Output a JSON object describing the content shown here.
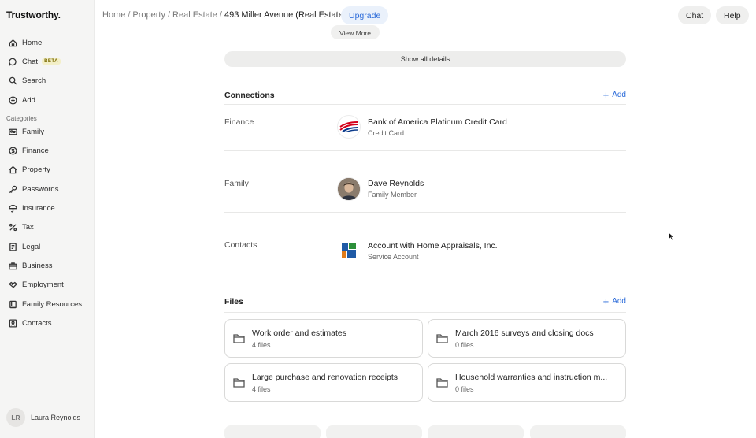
{
  "app": {
    "logo": "Trustworthy."
  },
  "sidebar": {
    "items": [
      {
        "label": "Home",
        "icon": "home-icon"
      },
      {
        "label": "Chat",
        "icon": "chat-icon",
        "badge": "BETA"
      },
      {
        "label": "Search",
        "icon": "search-icon"
      },
      {
        "label": "Add",
        "icon": "plus-circle-icon"
      }
    ],
    "categories_label": "Categories",
    "categories": [
      {
        "label": "Family",
        "icon": "id-card-icon"
      },
      {
        "label": "Finance",
        "icon": "dollar-circle-icon"
      },
      {
        "label": "Property",
        "icon": "house-icon"
      },
      {
        "label": "Passwords",
        "icon": "key-icon"
      },
      {
        "label": "Insurance",
        "icon": "umbrella-icon"
      },
      {
        "label": "Tax",
        "icon": "percent-icon"
      },
      {
        "label": "Legal",
        "icon": "document-icon"
      },
      {
        "label": "Business",
        "icon": "briefcase-icon"
      },
      {
        "label": "Employment",
        "icon": "handshake-icon"
      },
      {
        "label": "Family Resources",
        "icon": "book-icon"
      },
      {
        "label": "Contacts",
        "icon": "contact-icon"
      }
    ],
    "user": {
      "initials": "LR",
      "name": "Laura Reynolds"
    }
  },
  "header": {
    "breadcrumbs": [
      "Home",
      "Property",
      "Real Estate"
    ],
    "current": "493 Miller Avenue (Real Estate)",
    "separator": "/",
    "upgrade_label": "Upgrade",
    "chat_label": "Chat",
    "help_label": "Help"
  },
  "main": {
    "view_more_label": "View More",
    "show_all_label": "Show all details",
    "connections": {
      "title": "Connections",
      "add_label": "Add",
      "rows": [
        {
          "category": "Finance",
          "name": "Bank of America Platinum Credit Card",
          "subtitle": "Credit Card",
          "logo": "bank-of-america-logo"
        },
        {
          "category": "Family",
          "name": "Dave Reynolds",
          "subtitle": "Family Member",
          "logo": "person-avatar"
        },
        {
          "category": "Contacts",
          "name": "Account with Home Appraisals, Inc.",
          "subtitle": "Service Account",
          "logo": "home-appraisals-logo"
        }
      ]
    },
    "files": {
      "title": "Files",
      "add_label": "Add",
      "items": [
        {
          "title": "Work order and estimates",
          "count": "4 files"
        },
        {
          "title": "March 2016 surveys and closing docs",
          "count": "0 files"
        },
        {
          "title": "Large purchase and renovation receipts",
          "count": "4 files"
        },
        {
          "title": "Household warranties and instruction m...",
          "count": "0 files"
        }
      ]
    }
  },
  "colors": {
    "accent": "#2a6ad9",
    "sidebar_bg": "#f5f5f4",
    "beta_bg": "#f3efc7"
  }
}
